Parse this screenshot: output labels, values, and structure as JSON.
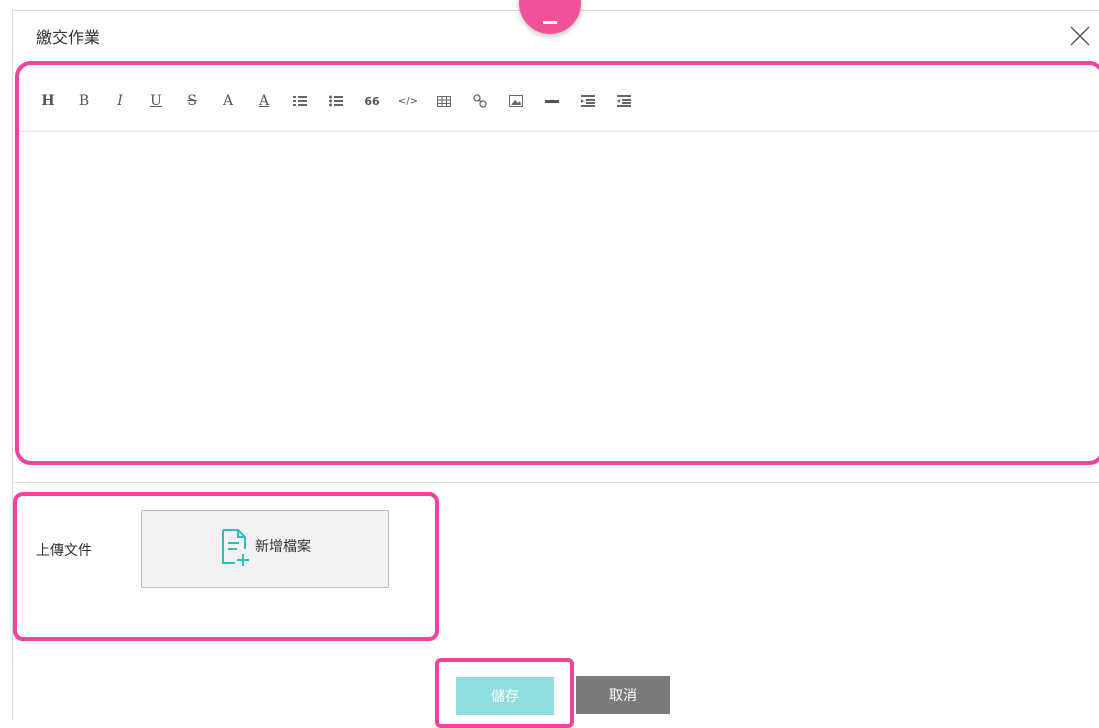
{
  "dialog": {
    "title": "繳交作業",
    "close_icon": "close-icon"
  },
  "editor": {
    "toolbar": [
      {
        "name": "heading",
        "label": "H"
      },
      {
        "name": "bold",
        "label": "B"
      },
      {
        "name": "italic",
        "label": "I"
      },
      {
        "name": "underline",
        "label": "U"
      },
      {
        "name": "strikethrough",
        "label": "S"
      },
      {
        "name": "font-color",
        "label": "A"
      },
      {
        "name": "background-color",
        "label": "A"
      },
      {
        "name": "ordered-list",
        "label": ""
      },
      {
        "name": "unordered-list",
        "label": ""
      },
      {
        "name": "blockquote",
        "label": "66"
      },
      {
        "name": "code",
        "label": "</>"
      },
      {
        "name": "table",
        "label": ""
      },
      {
        "name": "link",
        "label": ""
      },
      {
        "name": "image",
        "label": ""
      },
      {
        "name": "horizontal-rule",
        "label": ""
      },
      {
        "name": "indent",
        "label": ""
      },
      {
        "name": "outdent",
        "label": ""
      }
    ],
    "content": ""
  },
  "upload": {
    "label": "上傳文件",
    "add_file_label": "新增檔案"
  },
  "actions": {
    "save_label": "儲存",
    "cancel_label": "取消"
  },
  "colors": {
    "highlight": "#f0439a",
    "save": "#8fdfe0",
    "cancel": "#7b7b7b",
    "file_icon": "#2bbfbf"
  }
}
